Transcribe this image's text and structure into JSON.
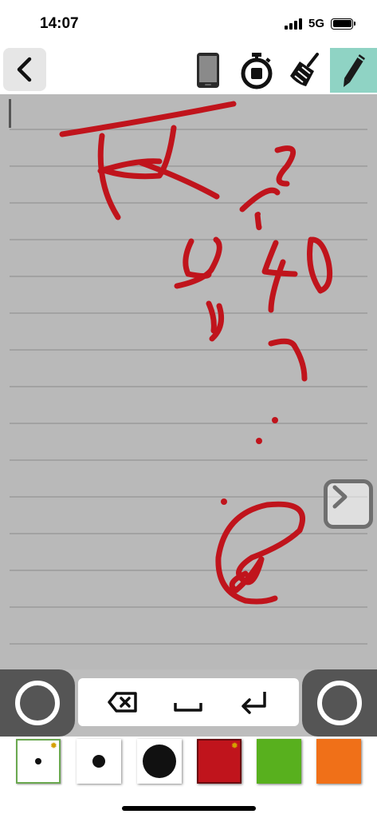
{
  "status_bar": {
    "time": "14:07",
    "network": "5G",
    "signal_bars": 4,
    "battery_level": 0.95
  },
  "toolbar": {
    "icons": [
      "chevron-left-icon",
      "phone-icon",
      "stopwatch-icon",
      "broom-icon",
      "pencil-icon"
    ],
    "active_tool": "pencil",
    "active_color": "#8fd3c4"
  },
  "canvas": {
    "background": "#b9b9b9",
    "line_color": "#9a9a9a",
    "ink_color": "#c0141c"
  },
  "keypad": {
    "keys": [
      "backspace-icon",
      "space-icon",
      "return-icon"
    ]
  },
  "palette": {
    "swatches": [
      {
        "kind": "pen-size",
        "size": "small",
        "selected": true
      },
      {
        "kind": "pen-size",
        "size": "medium"
      },
      {
        "kind": "pen-size",
        "size": "large"
      },
      {
        "kind": "color",
        "color": "#c0141c",
        "selected": true
      },
      {
        "kind": "color",
        "color": "#58b01e"
      },
      {
        "kind": "color",
        "color": "#f07018"
      }
    ]
  }
}
